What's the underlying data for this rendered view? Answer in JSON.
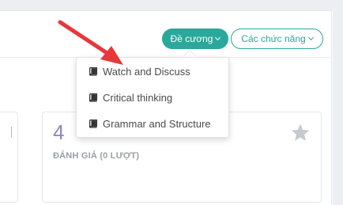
{
  "toolbar": {
    "outline_label": "Đề cương",
    "functions_label": "Các chức năng"
  },
  "outline_menu": {
    "items": [
      {
        "label": "Watch and Discuss",
        "icon": "book-icon"
      },
      {
        "label": "Critical thinking",
        "icon": "book-icon"
      },
      {
        "label": "Grammar and Structure",
        "icon": "book-icon"
      }
    ]
  },
  "rating_card": {
    "value": "4",
    "label": "ĐÁNH GIÁ (0 LƯỢT)",
    "star_icon": "star-icon"
  },
  "annotation": {
    "arrow_color": "#e8373b"
  },
  "colors": {
    "accent": "#2aa89b",
    "rating_number": "#8e86bf",
    "muted_label": "#9aa0a6",
    "star": "#c5c9d0"
  }
}
